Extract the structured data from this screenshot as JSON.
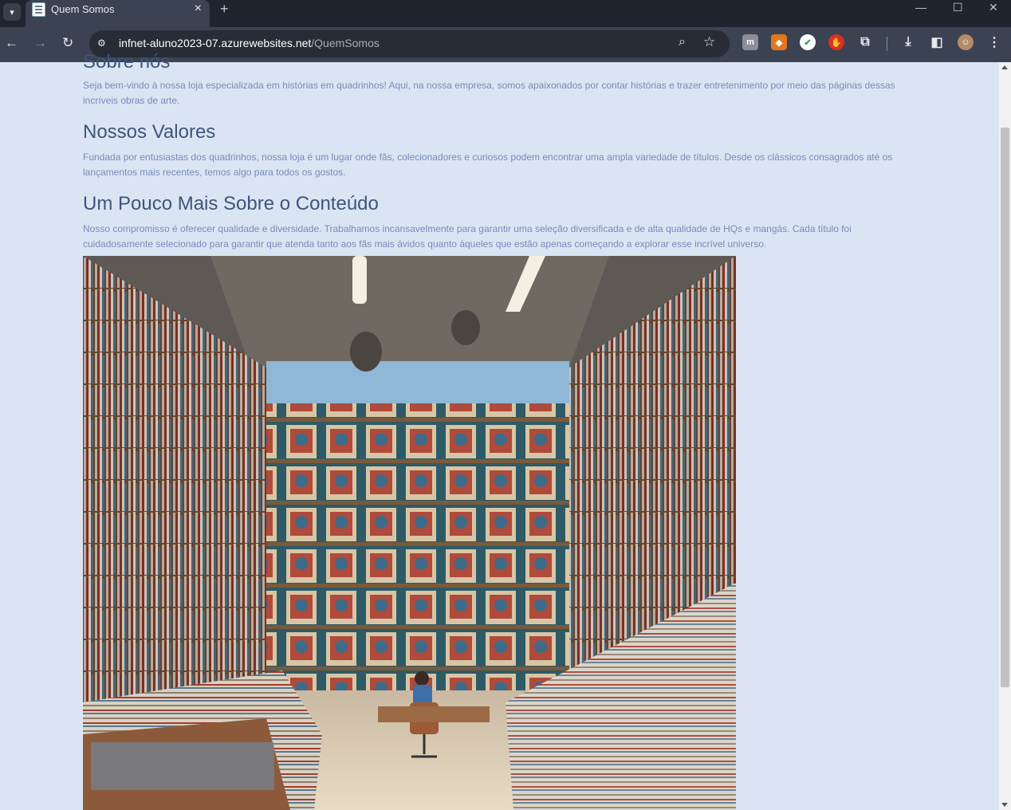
{
  "browser": {
    "tab_title": "Quem Somos",
    "url_host": "infnet-aluno2023-07.azurewebsites.net",
    "url_path": "/QuemSomos",
    "new_tab": "+",
    "close_tab": "×"
  },
  "page": {
    "section1_title": "Sobre nós",
    "section1_text": "Seja bem-vindo à nossa loja especializada em histórias em quadrinhos! Aqui, na nossa empresa, somos apaixonados por contar histórias e trazer entretenimento por meio das páginas dessas incríveis obras de arte.",
    "section2_title": "Nossos Valores",
    "section2_text": "Fundada por entusiastas dos quadrinhos, nossa loja é um lugar onde fãs, colecionadores e curiosos podem encontrar uma ampla variedade de títulos. Desde os clássicos consagrados até os lançamentos mais recentes, temos algo para todos os gostos.",
    "section3_title": "Um Pouco Mais Sobre o Conteúdo",
    "section3_text": "Nosso compromisso é oferecer qualidade e diversidade. Trabalhamos incansavelmente para garantir uma seleção diversificada e de alta qualidade de HQs e mangás. Cada título foi cuidadosamente selecionado para garantir que atenda tanto aos fãs mais ávidos quanto àqueles que estão apenas começando a explorar esse incrível universo."
  },
  "colors": {
    "page_bg": "#dbe4f3",
    "heading": "#3f557a",
    "text": "#7a8ab8"
  }
}
